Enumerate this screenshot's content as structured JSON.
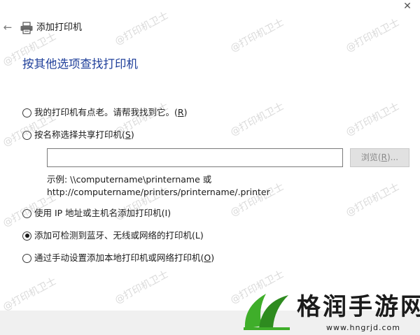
{
  "window": {
    "back_glyph": "←",
    "close_glyph": "✕",
    "title": "添加打印机"
  },
  "heading": "按其他选项查找打印机",
  "options": [
    {
      "label": "我的打印机有点老。请帮我找到它。(",
      "key": "R",
      "suffix": ")",
      "checked": false
    },
    {
      "label": "按名称选择共享打印机(",
      "key": "S",
      "suffix": ")",
      "checked": false
    },
    {
      "label": "使用 IP 地址或主机名添加打印机(I)",
      "key": "",
      "suffix": "",
      "checked": false
    },
    {
      "label": "添加可检测到蓝牙、无线或网络的打印机(L)",
      "key": "",
      "suffix": "",
      "checked": true
    },
    {
      "label": "通过手动设置添加本地打印机或网络打印机(",
      "key": "O",
      "suffix": ")",
      "checked": false
    }
  ],
  "shared_printer": {
    "input_value": "",
    "browse_label_pre": "浏览(",
    "browse_key": "R",
    "browse_label_post": ")..."
  },
  "example": {
    "line1": "示例: \\\\computername\\printername 或",
    "line2": "http://computername/printers/printername/.printer"
  },
  "watermark": {
    "text": "@打印机卫士",
    "logo_text": "格润手游网",
    "logo_url": "www.hngrjd.com"
  },
  "colors": {
    "heading": "#1f3f9a",
    "logo_green": "#3fae2a"
  }
}
